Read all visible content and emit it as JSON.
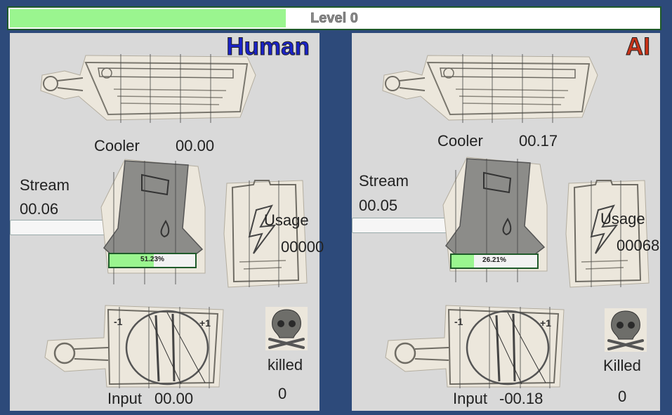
{
  "level": {
    "label": "Level 0",
    "progress": 0.425
  },
  "human": {
    "name": "Human",
    "name_color": "#1a22c8",
    "cooler_label": "Cooler",
    "cooler_value": "00.00",
    "stream_label": "Stream",
    "stream_value": "00.06",
    "usage_label": "Usage",
    "usage_value": "00000",
    "heat_percent_label": "51.23%",
    "heat_progress": 0.5123,
    "killed_label": "killed",
    "killed_count": "0",
    "input_label": "Input",
    "input_value": "00.00"
  },
  "ai": {
    "name": "AI",
    "name_color": "#c83218",
    "cooler_label": "Cooler",
    "cooler_value": "00.17",
    "stream_label": "Stream",
    "stream_value": "00.05",
    "usage_label": "Usage",
    "usage_value": "00068",
    "heat_percent_label": "26.21%",
    "heat_progress": 0.2621,
    "killed_label": "Killed",
    "killed_count": "0",
    "input_label": "Input",
    "input_value": "-00.18"
  },
  "icons": {
    "cooler": "cooler-sketch-icon",
    "heater": "heater-sketch-icon",
    "battery": "battery-sketch-icon",
    "dial": "input-dial-sketch-icon",
    "skull": "skull-crossbones-icon"
  },
  "colors": {
    "background": "#2d4a7a",
    "panel": "#d9d9d9",
    "progress_fill": "#9af58f",
    "progress_border": "#1f5a2a"
  }
}
